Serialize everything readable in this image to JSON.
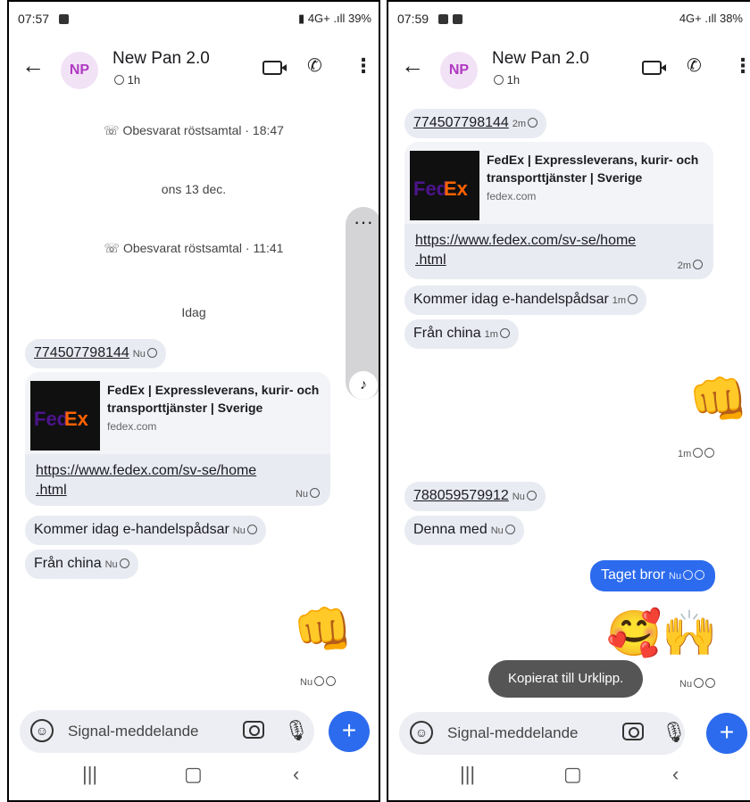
{
  "left": {
    "status": {
      "time": "07:57",
      "icons": "▮ 4G+ .ıll 39%"
    },
    "header": {
      "avatar": "NP",
      "title": "New Pan 2.0",
      "timer": "1h"
    },
    "events": {
      "missed_call_1": "Obesvarat röstsamtal · 18:47",
      "date_1": "ons 13 dec.",
      "missed_call_2": "Obesvarat röstsamtal · 11:41",
      "date_2": "Idag"
    },
    "messages": {
      "tracking": {
        "number": "774507798144",
        "time": "Nu"
      },
      "link_preview": {
        "title": "FedEx | Expressleverans, kurir- och transporttjänster | Sverige",
        "site": "fedex.com",
        "url_line1": "https://www.fedex.com/sv-se/home",
        "url_line2": ".html",
        "time": "Nu"
      },
      "msg1": {
        "text": "Kommer idag e-handelspådsar",
        "time": "Nu"
      },
      "msg2": {
        "text": "Från china",
        "time": "Nu"
      },
      "reaction": {
        "emoji": "👊",
        "time": "Nu"
      }
    },
    "composer": {
      "placeholder": "Signal-meddelande"
    }
  },
  "right": {
    "status": {
      "time": "07:59",
      "icons": "4G+ .ıll 38%"
    },
    "header": {
      "avatar": "NP",
      "title": "New Pan 2.0",
      "timer": "1h"
    },
    "messages": {
      "tracking": {
        "number": "774507798144",
        "time": "2m"
      },
      "link_preview": {
        "title": "FedEx | Expressleverans, kurir- och transporttjänster | Sverige",
        "site": "fedex.com",
        "url_line1": "https://www.fedex.com/sv-se/home",
        "url_line2": ".html",
        "time": "2m"
      },
      "msg1": {
        "text": "Kommer idag e-handelspådsar",
        "time": "1m"
      },
      "msg2": {
        "text": "Från china",
        "time": "1m"
      },
      "reaction": {
        "emoji": "👊",
        "time": "1m"
      },
      "tracking2": {
        "number": "788059579912",
        "time": "Nu"
      },
      "msg3": {
        "text": "Denna med",
        "time": "Nu"
      },
      "outgoing": {
        "text": "Taget bror",
        "time": "Nu"
      },
      "emojis": {
        "emoji": "🥰🙌",
        "time": "Nu"
      }
    },
    "toast": "Kopierat till Urklipp.",
    "composer": {
      "placeholder": "Signal-meddelande"
    }
  },
  "icons": {
    "back": "arrow-left-icon",
    "video": "video-call-icon",
    "phone": "phone-icon",
    "menu": "kebab-menu-icon",
    "timer": "timer-icon",
    "missed_call": "missed-call-icon",
    "emoji": "emoji-icon",
    "camera": "camera-icon",
    "mic": "microphone-icon",
    "add": "plus-icon",
    "recents": "recents-icon",
    "home": "home-icon",
    "nav_back": "nav-back-icon"
  },
  "colors": {
    "accent": "#2c6bed",
    "avatar_bg": "#f2e2f6",
    "avatar_text": "#b03ac2",
    "bubble": "#e9ebf2"
  }
}
